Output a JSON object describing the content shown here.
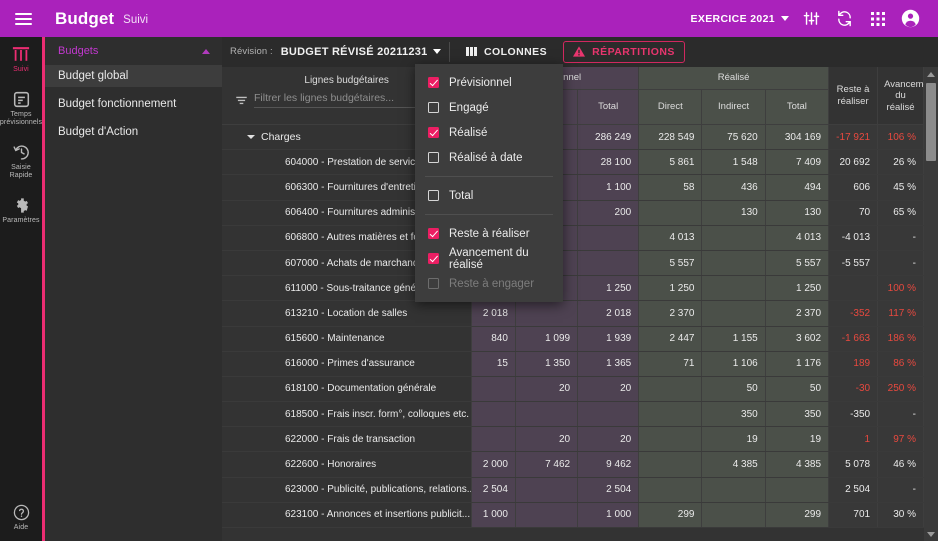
{
  "topbar": {
    "menu_icon": "hamburger-menu-icon",
    "title": "Budget",
    "subtitle": "Suivi",
    "exercice_label": "EXERCICE 2021",
    "icons": [
      "tune-sliders-icon",
      "sync-refresh-icon",
      "apps-grid-icon",
      "account-circle-icon"
    ]
  },
  "rail": {
    "items": [
      {
        "label": "Suivi",
        "icon": "columns-chart-icon",
        "active": true
      },
      {
        "label": "Temps\nprévisionnels",
        "icon": "timesheet-icon",
        "active": false
      },
      {
        "label": "Saisie\nRapide",
        "icon": "clock-history-icon",
        "active": false
      },
      {
        "label": "Paramètres",
        "icon": "gear-icon",
        "active": false
      }
    ],
    "bottom": {
      "label": "Aide",
      "icon": "help-circle-icon"
    }
  },
  "nav": {
    "header": "Budgets",
    "header_icon": "chevron-up-icon",
    "items": [
      {
        "label": "Budget global",
        "selected": true
      },
      {
        "label": "Budget fonctionnement",
        "selected": false
      },
      {
        "label": "Budget d'Action",
        "selected": false
      }
    ]
  },
  "toolbar": {
    "revision_label": "Révision :",
    "revision_value": "BUDGET RÉVISÉ 20211231",
    "revision_chevron": "chevron-down-icon",
    "colonnes_label": "COLONNES",
    "colonnes_icon": "columns-bars-icon",
    "repartitions_label": "RÉPARTITIONS",
    "repartitions_icon": "warning-triangle-icon"
  },
  "columns_menu": {
    "groups": [
      [
        {
          "label": "Prévisionnel",
          "checked": true,
          "disabled": false
        },
        {
          "label": "Engagé",
          "checked": false,
          "disabled": false
        },
        {
          "label": "Réalisé",
          "checked": true,
          "disabled": false
        },
        {
          "label": "Réalisé à date",
          "checked": false,
          "disabled": false
        }
      ],
      [
        {
          "label": "Total",
          "checked": false,
          "disabled": false
        }
      ],
      [
        {
          "label": "Reste à réaliser",
          "checked": true,
          "disabled": false
        },
        {
          "label": "Avancement du réalisé",
          "checked": true,
          "disabled": false
        },
        {
          "label": "Reste à engager",
          "checked": false,
          "disabled": true
        }
      ]
    ]
  },
  "table": {
    "name_header": "Lignes budgétaires",
    "filter_placeholder": "Filtrer les lignes budgétaires...",
    "filter_value": "",
    "filter_icon": "filter-funnel-icon",
    "group_headers": [
      {
        "label": "Prévisionnel",
        "span": 3,
        "style": "prev"
      },
      {
        "label": "Réalisé",
        "span": 3,
        "style": "real"
      }
    ],
    "sub_headers_prev": [
      "",
      "",
      "Total"
    ],
    "sub_headers_real": [
      "Direct",
      "Indirect",
      "Total"
    ],
    "col_reste": "Reste à\nréaliser",
    "col_reste_l1": "Reste à",
    "col_reste_l2": "réaliser",
    "col_avanc_l1": "Avancement",
    "col_avanc_l2": "du réalisé",
    "rows": [
      {
        "label": "Charges",
        "level": 0,
        "expanded": true,
        "p": [
          "",
          "",
          "286 249"
        ],
        "r": [
          "228 549",
          "75 620",
          "304 169"
        ],
        "reste": "-17 921",
        "reste_neg": true,
        "avanc": "106 %",
        "avanc_red": true
      },
      {
        "label": "604000 - Prestation de services",
        "level": 1,
        "p": [
          "",
          "",
          "28 100"
        ],
        "r": [
          "5 861",
          "1 548",
          "7 409"
        ],
        "reste": "20 692",
        "reste_neg": false,
        "avanc": "26 %",
        "avanc_red": false
      },
      {
        "label": "606300 - Fournitures d'entretien et...",
        "level": 1,
        "p": [
          "",
          "",
          "1 100"
        ],
        "r": [
          "58",
          "436",
          "494"
        ],
        "reste": "606",
        "reste_neg": false,
        "avanc": "45 %",
        "avanc_red": false
      },
      {
        "label": "606400 - Fournitures administrativ...",
        "level": 1,
        "p": [
          "",
          "",
          "200"
        ],
        "r": [
          "",
          "130",
          "130"
        ],
        "reste": "70",
        "reste_neg": false,
        "avanc": "65 %",
        "avanc_red": false
      },
      {
        "label": "606800 - Autres matières et fourni...",
        "level": 1,
        "p": [
          "",
          "",
          ""
        ],
        "r": [
          "4 013",
          "",
          "4 013"
        ],
        "reste": "-4 013",
        "reste_neg": false,
        "avanc": "-",
        "avanc_red": false
      },
      {
        "label": "607000 - Achats de marchandises",
        "level": 1,
        "p": [
          "",
          "",
          ""
        ],
        "r": [
          "5 557",
          "",
          "5 557"
        ],
        "reste": "-5 557",
        "reste_neg": false,
        "avanc": "-",
        "avanc_red": false
      },
      {
        "label": "611000 - Sous-traitance générale",
        "level": 1,
        "p": [
          "1 250",
          "",
          "1 250"
        ],
        "r": [
          "1 250",
          "",
          "1 250"
        ],
        "reste": "",
        "reste_neg": false,
        "avanc": "100 %",
        "avanc_red": true
      },
      {
        "label": "613210 - Location de salles",
        "level": 1,
        "p": [
          "2 018",
          "",
          "2 018"
        ],
        "r": [
          "2 370",
          "",
          "2 370"
        ],
        "reste": "-352",
        "reste_neg": true,
        "avanc": "117 %",
        "avanc_red": true
      },
      {
        "label": "615600 - Maintenance",
        "level": 1,
        "p": [
          "840",
          "1 099",
          "1 939"
        ],
        "r": [
          "2 447",
          "1 155",
          "3 602"
        ],
        "reste": "-1 663",
        "reste_neg": true,
        "avanc": "186 %",
        "avanc_red": true
      },
      {
        "label": "616000 - Primes d'assurance",
        "level": 1,
        "p": [
          "15",
          "1 350",
          "1 365"
        ],
        "r": [
          "71",
          "1 106",
          "1 176"
        ],
        "reste": "189",
        "reste_neg": true,
        "avanc": "86 %",
        "avanc_red": true
      },
      {
        "label": "618100 - Documentation générale",
        "level": 1,
        "p": [
          "",
          "20",
          "20"
        ],
        "r": [
          "",
          "50",
          "50"
        ],
        "reste": "-30",
        "reste_neg": true,
        "avanc": "250 %",
        "avanc_red": true
      },
      {
        "label": "618500 - Frais inscr. form°, colloques etc.",
        "level": 1,
        "p": [
          "",
          "",
          ""
        ],
        "r": [
          "",
          "350",
          "350"
        ],
        "reste": "-350",
        "reste_neg": false,
        "avanc": "-",
        "avanc_red": false
      },
      {
        "label": "622000 - Frais de transaction",
        "level": 1,
        "p": [
          "",
          "20",
          "20"
        ],
        "r": [
          "",
          "19",
          "19"
        ],
        "reste": "1",
        "reste_neg": true,
        "avanc": "97 %",
        "avanc_red": true
      },
      {
        "label": "622600 - Honoraires",
        "level": 1,
        "p": [
          "2 000",
          "7 462",
          "9 462"
        ],
        "r": [
          "",
          "4 385",
          "4 385"
        ],
        "reste": "5 078",
        "reste_neg": false,
        "avanc": "46 %",
        "avanc_red": false
      },
      {
        "label": "623000 - Publicité, publications, relations...",
        "level": 1,
        "p": [
          "2 504",
          "",
          "2 504"
        ],
        "r": [
          "",
          "",
          ""
        ],
        "reste": "2 504",
        "reste_neg": false,
        "avanc": "-",
        "avanc_red": false
      },
      {
        "label": "623100 - Annonces et insertions publicit...",
        "level": 1,
        "p": [
          "1 000",
          "",
          "1 000"
        ],
        "r": [
          "299",
          "",
          "299"
        ],
        "reste": "701",
        "reste_neg": false,
        "avanc": "30 %",
        "avanc_red": false
      }
    ]
  },
  "scrollbar": {
    "up_icon": "scroll-up-arrow-icon",
    "down_icon": "scroll-down-arrow-icon"
  },
  "colors": {
    "brand_purple": "#aa22bb",
    "accent_pink": "#ec1e63",
    "prev_group": "#4e4252",
    "real_group": "#4b5049",
    "negative_red": "#e8493f"
  }
}
